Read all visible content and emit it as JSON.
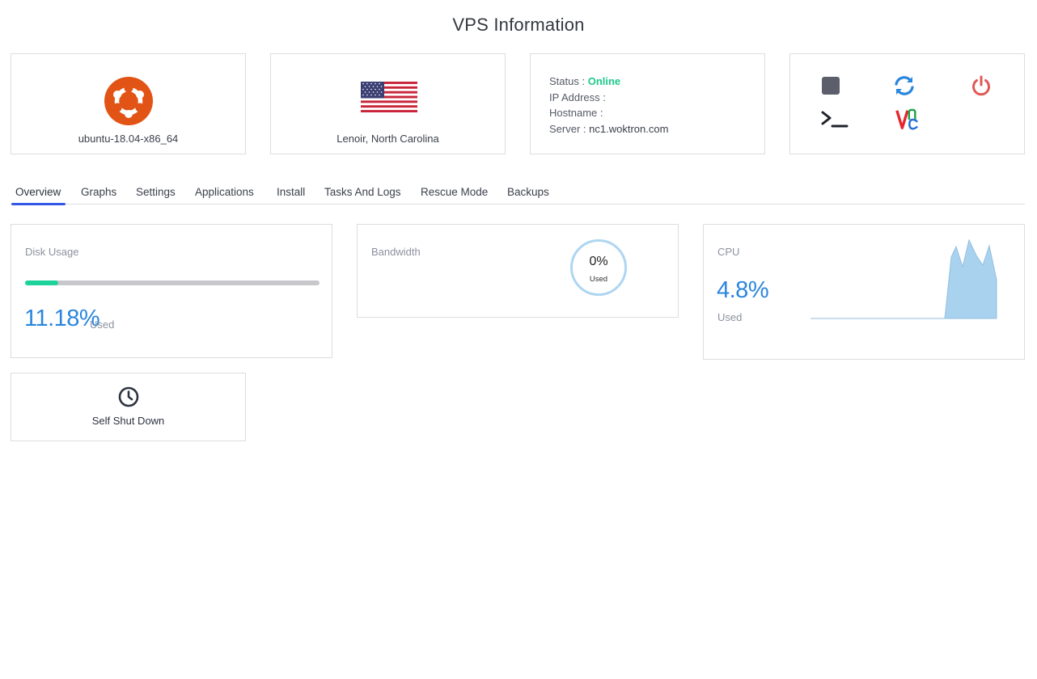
{
  "page": {
    "title": "VPS Information"
  },
  "os": {
    "name": "ubuntu-18.04-x86_64",
    "icon": "ubuntu-logo-icon",
    "color": "#e25416"
  },
  "location": {
    "name": "Lenoir, North Carolina",
    "icon": "us-flag-icon"
  },
  "info": {
    "status_label": "Status :",
    "status_value": "Online",
    "ip_label": "IP Address :",
    "ip_value": "",
    "hostname_label": "Hostname :",
    "hostname_value": "",
    "server_label": "Server :",
    "server_value": "nc1.woktron.com",
    "status_color": "#1dc98b"
  },
  "actions": [
    {
      "name": "stop-icon",
      "color": "#5c5f6b"
    },
    {
      "name": "restart-icon",
      "color": "#2a86dd"
    },
    {
      "name": "power-icon",
      "color": "#e05a55"
    },
    {
      "name": "terminal-icon",
      "color": "#1f2229"
    },
    {
      "name": "vnc-icon",
      "color": "#e6252e"
    }
  ],
  "tabs": [
    {
      "label": "Overview",
      "active": true
    },
    {
      "label": "Graphs",
      "active": false
    },
    {
      "label": "Settings",
      "active": false
    },
    {
      "label": "Applications",
      "active": false
    },
    {
      "label": "Install",
      "active": false
    },
    {
      "label": "Tasks And Logs",
      "active": false
    },
    {
      "label": "Rescue Mode",
      "active": false
    },
    {
      "label": "Backups",
      "active": false
    }
  ],
  "disk": {
    "label": "Disk Usage",
    "value": "11.18%",
    "used_label": "Used",
    "fraction": 0.1118,
    "bar_color": "#1dd39a"
  },
  "bandwidth": {
    "label": "Bandwidth",
    "value": "0%",
    "used_label": "Used",
    "fraction": 0
  },
  "cpu": {
    "label": "CPU",
    "value": "4.8%",
    "used_label": "Used",
    "accent": "#2a86dd",
    "fill_color": "#a9d2ef"
  },
  "shutdown": {
    "label": "Self Shut Down",
    "icon": "clock-icon"
  }
}
